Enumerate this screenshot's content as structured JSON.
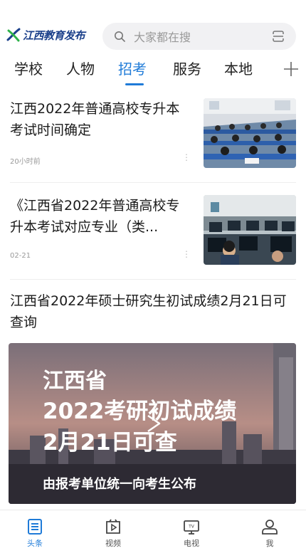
{
  "header": {
    "logo_text": "江西教育发布",
    "search_placeholder": "大家都在搜"
  },
  "tabs": [
    {
      "label": "学校",
      "active": false
    },
    {
      "label": "人物",
      "active": false
    },
    {
      "label": "招考",
      "active": true
    },
    {
      "label": "服务",
      "active": false
    },
    {
      "label": "本地",
      "active": false
    }
  ],
  "news": [
    {
      "title": "江西2022年普通高校专升本考试时间确定",
      "time": "20小时前"
    },
    {
      "title": "《江西省2022年普通高校专升本考试对应专业（类...",
      "time": "02-21"
    },
    {
      "title": "江西省2022年硕士研究生初试成绩2月21日可查询"
    }
  ],
  "video": {
    "line1": "江西省",
    "line2": "2022考研初试成绩",
    "line3": "2月21日可查",
    "caption": "由报考单位统一向考生公布"
  },
  "bottom_nav": [
    {
      "label": "头条",
      "icon": "headline-icon",
      "active": true
    },
    {
      "label": "视频",
      "icon": "video-icon",
      "active": false
    },
    {
      "label": "电视",
      "icon": "tv-icon",
      "active": false
    },
    {
      "label": "我",
      "icon": "profile-icon",
      "active": false
    }
  ],
  "colors": {
    "accent": "#1f7bd8"
  }
}
